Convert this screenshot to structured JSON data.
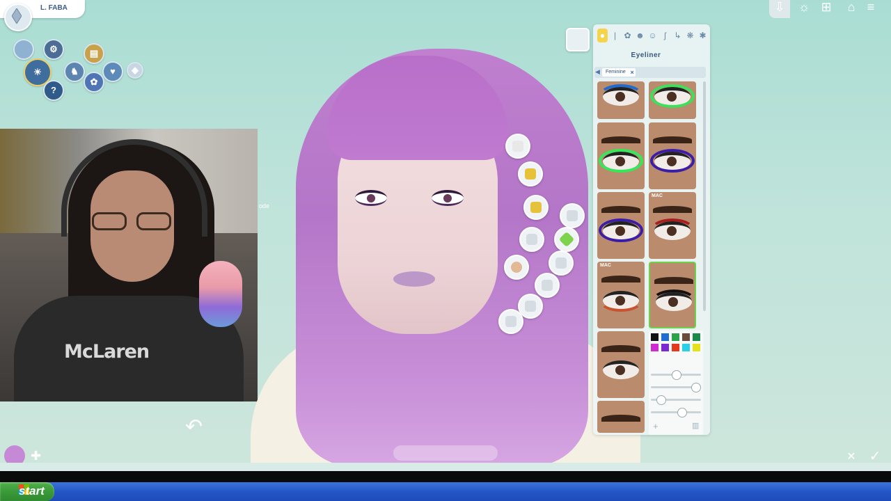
{
  "sim_name": "L. FABA",
  "help_symbol": "?",
  "webcam": {
    "shirt_logo": "McLaren",
    "overlay_text": "ode"
  },
  "panel": {
    "title": "Eyeliner",
    "filter_chip": "Feminine",
    "filter_remove": "×",
    "swatch_tags": [
      "MAC",
      "MAC"
    ],
    "colors": [
      "#111111",
      "#1f6bd1",
      "#2aa44a",
      "#6a4a3a",
      "#1b8a4b",
      "#d12ad1",
      "#7b2ad1",
      "#e23a1a",
      "#2ad1e6",
      "#e6e21a"
    ]
  },
  "taskbar": {
    "start_label": "start"
  },
  "icons": {
    "top_right": [
      "download-icon",
      "light-icon",
      "cart-icon",
      "gallery-icon",
      "menu-icon"
    ],
    "bottom_right": [
      "close-icon",
      "accept-icon"
    ]
  }
}
